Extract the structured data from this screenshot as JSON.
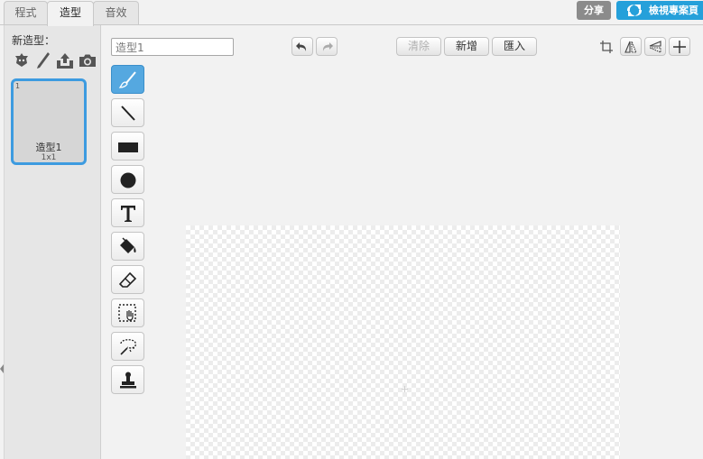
{
  "tabs": [
    {
      "label": "程式",
      "active": false
    },
    {
      "label": "造型",
      "active": true
    },
    {
      "label": "音效",
      "active": false
    }
  ],
  "header": {
    "share_label": "分享",
    "view_project_label": "檢視專案頁",
    "share_color": "#8b8b8b",
    "view_color": "#25a0da"
  },
  "sidebar": {
    "new_costume_label": "新造型：",
    "new_costume_icons": [
      "choose-from-library-icon",
      "paint-new-icon",
      "upload-file-icon",
      "camera-icon"
    ],
    "costumes": [
      {
        "index": "1",
        "name": "造型1",
        "size": "1x1",
        "selected": true
      }
    ]
  },
  "editor": {
    "costume_name_value": "造型1",
    "undo_icon": "undo-icon",
    "redo_icon": "redo-icon",
    "clear_label": "清除",
    "add_label": "新增",
    "import_label": "匯入",
    "right_icons": [
      "crop-icon",
      "flip-horizontal-icon",
      "flip-vertical-icon",
      "set-center-icon"
    ],
    "tools": [
      "brush-tool-icon",
      "line-tool-icon",
      "rectangle-tool-icon",
      "ellipse-tool-icon",
      "text-tool-icon",
      "fill-tool-icon",
      "eraser-tool-icon",
      "select-tool-icon",
      "magic-select-tool-icon",
      "stamp-tool-icon"
    ],
    "selected_tool": "brush-tool-icon",
    "accent_color": "#55a8e0"
  }
}
